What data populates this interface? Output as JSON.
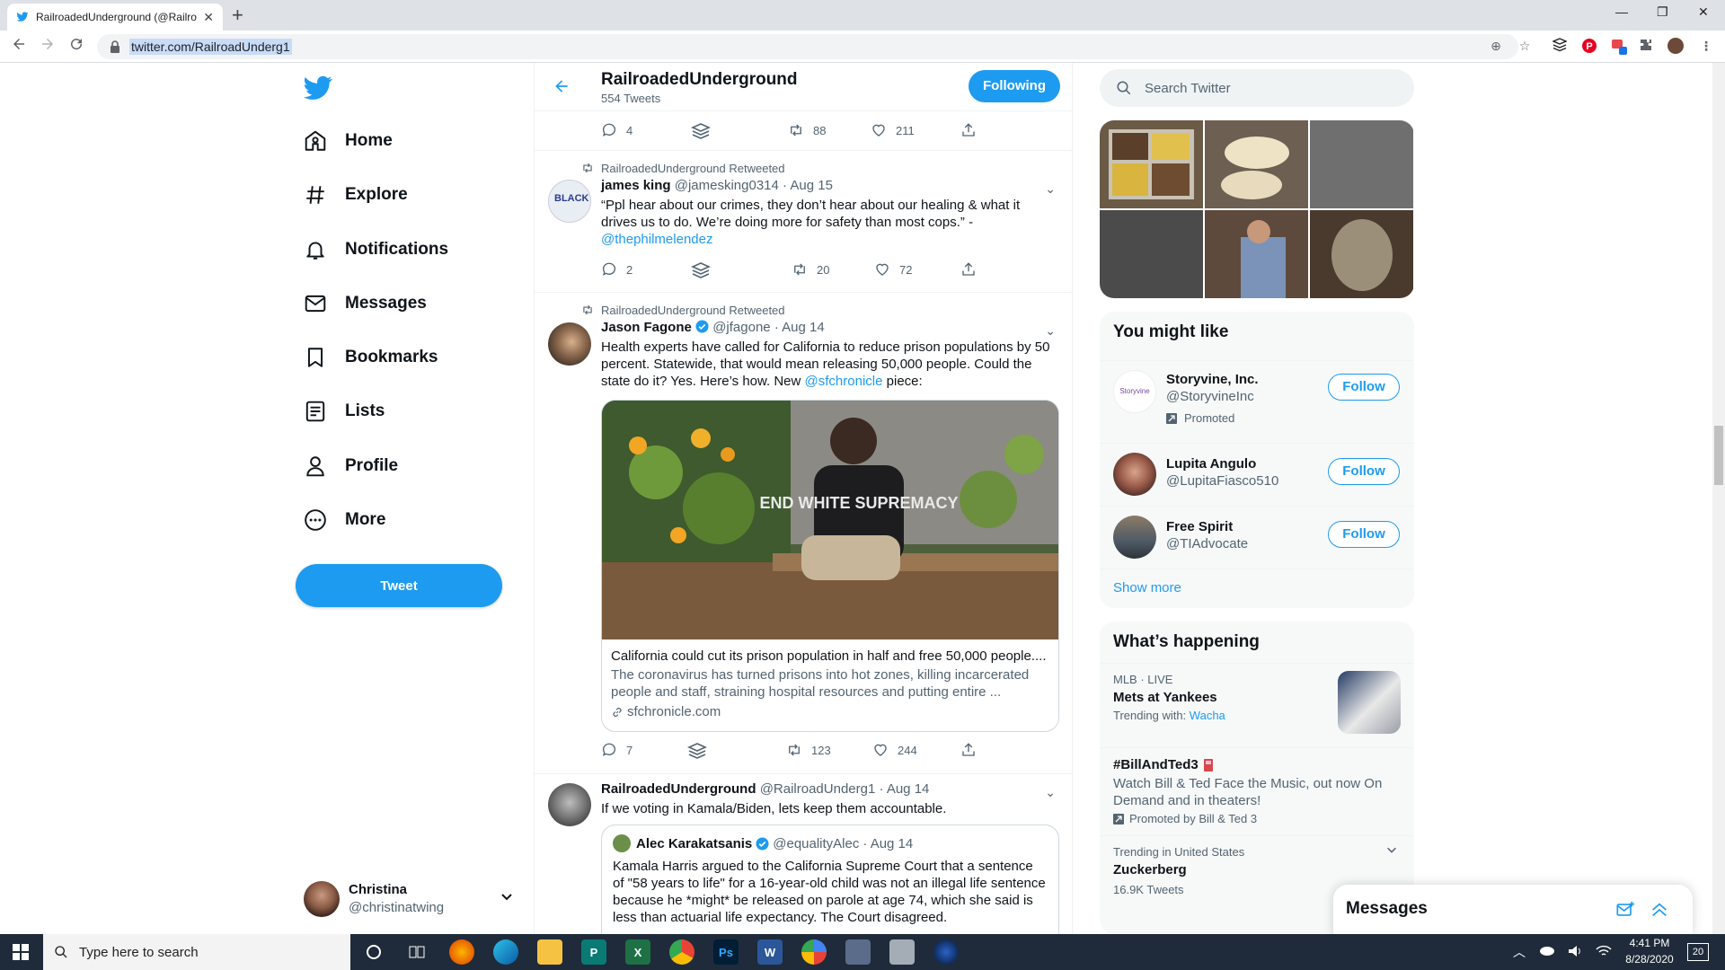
{
  "browser": {
    "tab_title": "RailroadedUnderground (@Railro",
    "url": "twitter.com/RailroadUnderg1",
    "close_glyph": "✕",
    "new_tab_glyph": "+",
    "window_controls": [
      "—",
      "❐",
      "✕"
    ]
  },
  "nav": {
    "items": [
      {
        "label": "Home",
        "icon": "home-icon"
      },
      {
        "label": "Explore",
        "icon": "hashtag-icon"
      },
      {
        "label": "Notifications",
        "icon": "bell-icon"
      },
      {
        "label": "Messages",
        "icon": "mail-icon"
      },
      {
        "label": "Bookmarks",
        "icon": "bookmark-icon"
      },
      {
        "label": "Lists",
        "icon": "list-icon"
      },
      {
        "label": "Profile",
        "icon": "person-icon"
      },
      {
        "label": "More",
        "icon": "more-icon"
      }
    ],
    "tweet_button": "Tweet",
    "account_name": "Christina",
    "account_handle": "@christinatwing"
  },
  "profile_header": {
    "name": "RailroadedUnderground",
    "tweet_count": "554 Tweets",
    "following_label": "Following"
  },
  "tweets": [
    {
      "actions": {
        "replies": "4",
        "retweets": "88",
        "likes": "211"
      }
    },
    {
      "retweeted_by": "RailroadedUnderground Retweeted",
      "name": "james king",
      "handle": "@jamesking0314",
      "date": "· Aug 15",
      "text": "“Ppl hear about our crimes, they don’t hear about our healing & what it drives us to do. We’re doing more for safety than most cops.” -",
      "mention": "@thephilmelendez",
      "actions": {
        "replies": "2",
        "retweets": "20",
        "likes": "72"
      }
    },
    {
      "retweeted_by": "RailroadedUnderground Retweeted",
      "name": "Jason Fagone",
      "handle": "@jfagone",
      "date": "· Aug 14",
      "text_before": "Health experts have called for California to reduce prison populations by 50 percent. Statewide, that would mean releasing 50,000 people. Could the state do it? Yes. Here’s how. New",
      "mention": "@sfchronicle",
      "text_after": "piece:",
      "shirt_text": "END WHITE SUPREMACY",
      "card_title": "California could cut its prison population in half and free 50,000 people....",
      "card_desc": "The coronavirus has turned prisons into hot zones, killing incarcerated people and staff, straining hospital resources and putting entire ...",
      "card_domain": "sfchronicle.com",
      "actions": {
        "replies": "7",
        "retweets": "123",
        "likes": "244"
      }
    },
    {
      "name": "RailroadedUnderground",
      "handle": "@RailroadUnderg1",
      "date": "· Aug 14",
      "text": "If we voting in Kamala/Biden, lets keep them accountable.",
      "quote": {
        "name": "Alec Karakatsanis",
        "handle": "@equalityAlec",
        "date": "· Aug 14",
        "text": "Kamala Harris argued to the California Supreme Court that a sentence of \"58 years to life\" for a 16-year-old child was not an illegal life sentence because he *might* be released on parole at age 74, which she said is less than actuarial life expectancy. The Court disagreed."
      }
    }
  ],
  "right": {
    "search_placeholder": "Search Twitter",
    "you_might_like": {
      "title": "You might like",
      "follow_label": "Follow",
      "accounts": [
        {
          "name": "Storyvine, Inc.",
          "handle": "@StoryvineInc",
          "promoted": "Promoted",
          "logo_text": "Storyvine"
        },
        {
          "name": "Lupita Angulo",
          "handle": "@LupitaFiasco510"
        },
        {
          "name": "Free Spirit",
          "handle": "@TIAdvocate"
        }
      ],
      "show_more": "Show more"
    },
    "whats_happening": {
      "title": "What’s happening",
      "trends": [
        {
          "context": "MLB · LIVE",
          "title": "Mets at Yankees",
          "trending_with": "Trending with:",
          "trending_link": "Wacha"
        },
        {
          "title": "#BillAndTed3",
          "desc": "Watch Bill & Ted Face the Music, out now On Demand and in theaters!",
          "promoted": "Promoted by Bill & Ted 3"
        },
        {
          "context": "Trending in United States",
          "title": "Zuckerberg",
          "count": "16.9K Tweets"
        }
      ]
    },
    "messages_drawer": "Messages"
  },
  "taskbar": {
    "search_placeholder": "Type here to search",
    "time": "4:41 PM",
    "date": "8/28/2020",
    "notifications": "20",
    "apps": [
      "P",
      "X",
      "Ps",
      "W"
    ]
  },
  "colors": {
    "twitter_blue": "#1d9bf0",
    "text_muted": "#536471"
  }
}
